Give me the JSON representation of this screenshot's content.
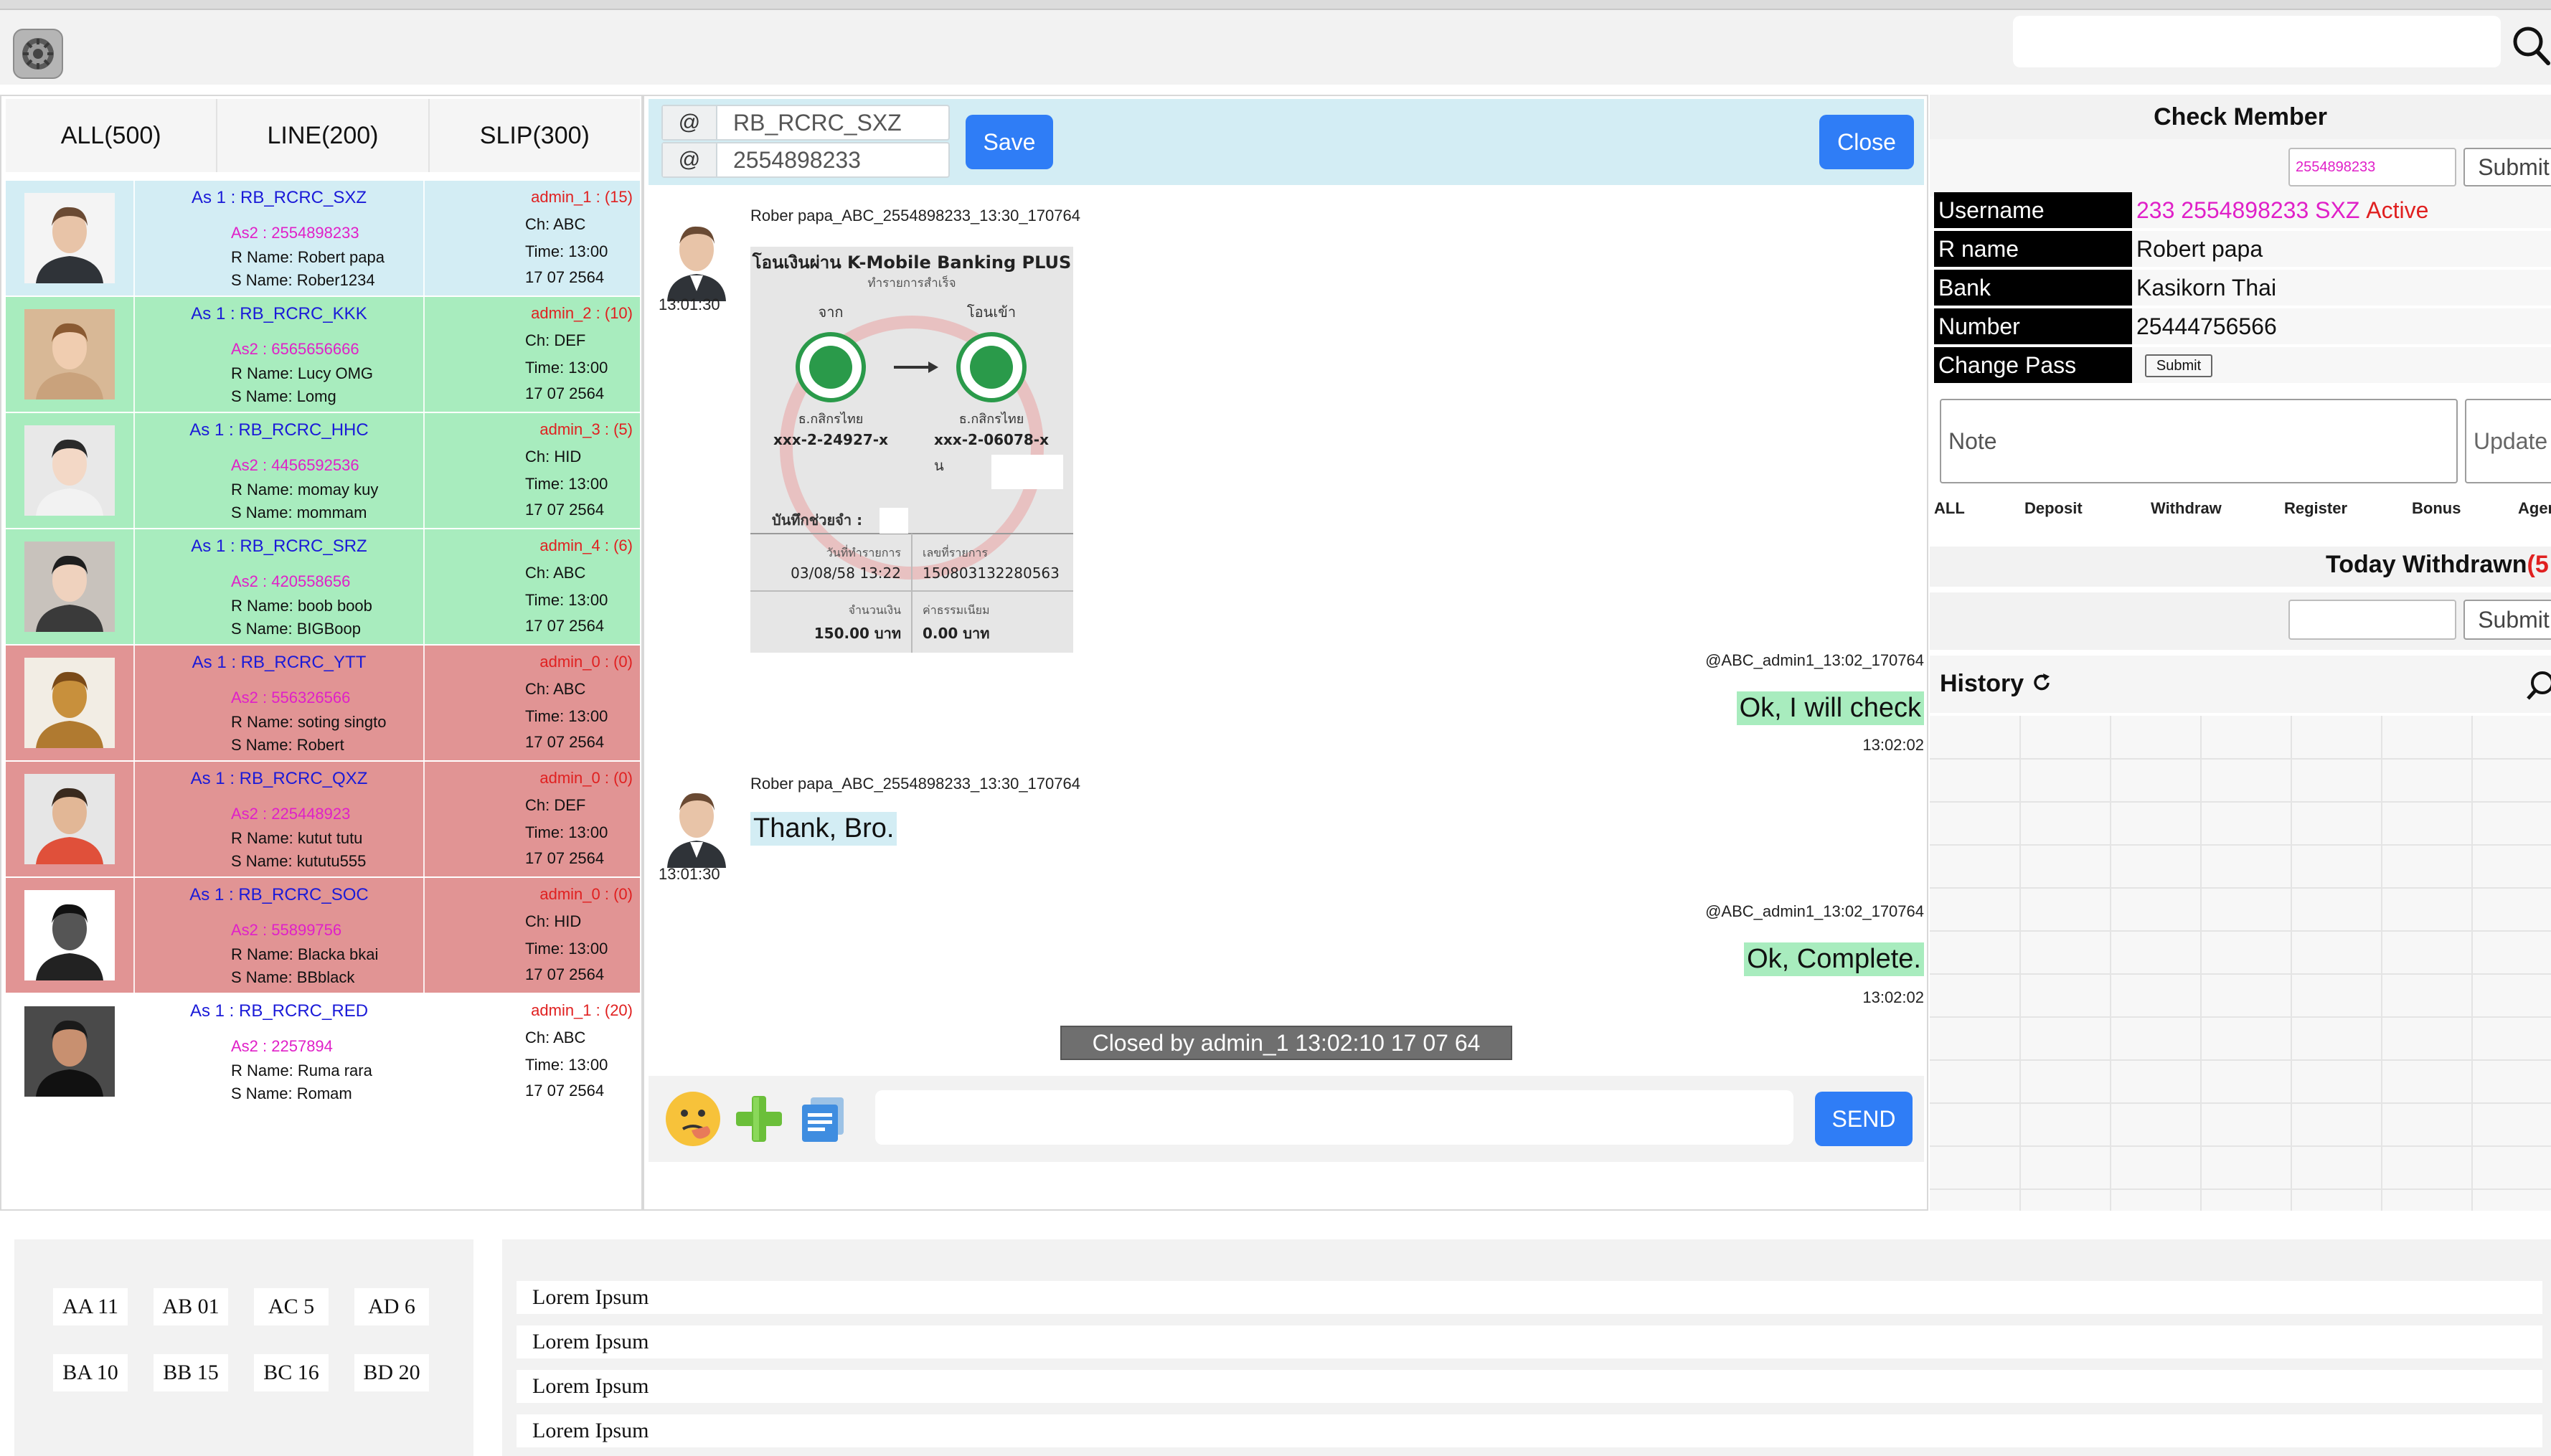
{
  "topbar": {
    "search_placeholder": ""
  },
  "tabs": [
    {
      "label": "ALL(500)"
    },
    {
      "label": "LINE(200)"
    },
    {
      "label": "SLIP(300)"
    }
  ],
  "conversations": [
    {
      "as1": "As 1 : RB_RCRC_SXZ",
      "as2": "As2 : 2554898233",
      "rname": "R Name: Robert papa",
      "sname": "S Name: Rober1234",
      "admin": "admin_1 : (15)",
      "ch": "Ch: ABC",
      "time": "Time: 13:00",
      "date": "17 07 2564"
    },
    {
      "as1": "As 1 : RB_RCRC_KKK",
      "as2": "As2 : 6565656666",
      "rname": "R Name: Lucy OMG",
      "sname": "S Name: Lomg",
      "admin": "admin_2 : (10)",
      "ch": "Ch: DEF",
      "time": "Time: 13:00",
      "date": "17 07 2564"
    },
    {
      "as1": "As 1 : RB_RCRC_HHC",
      "as2": "As2 : 4456592536",
      "rname": "R Name: momay kuy",
      "sname": "S Name: mommam",
      "admin": "admin_3 : (5)",
      "ch": "Ch: HID",
      "time": "Time: 13:00",
      "date": "17 07 2564"
    },
    {
      "as1": "As 1 : RB_RCRC_SRZ",
      "as2": "As2 : 420558656",
      "rname": "R Name: boob boob",
      "sname": "S Name: BIGBoop",
      "admin": "admin_4 : (6)",
      "ch": "Ch: ABC",
      "time": "Time: 13:00",
      "date": "17 07 2564"
    },
    {
      "as1": "As 1 : RB_RCRC_YTT",
      "as2": "As2 : 556326566",
      "rname": "R Name: soting singto",
      "sname": "S Name: Robert",
      "admin": "admin_0 : (0)",
      "ch": "Ch: ABC",
      "time": "Time: 13:00",
      "date": "17 07 2564"
    },
    {
      "as1": "As 1 : RB_RCRC_QXZ",
      "as2": "As2 : 225448923",
      "rname": "R Name: kutut tutu",
      "sname": "S Name: kututu555",
      "admin": "admin_0 : (0)",
      "ch": "Ch: DEF",
      "time": "Time: 13:00",
      "date": "17 07 2564"
    },
    {
      "as1": "As 1 : RB_RCRC_SOC",
      "as2": "As2 : 55899756",
      "rname": "R Name: Blacka bkai",
      "sname": "S Name: BBblack",
      "admin": "admin_0 : (0)",
      "ch": "Ch: HID",
      "time": "Time: 13:00",
      "date": "17 07 2564"
    },
    {
      "as1": "As 1 : RB_RCRC_RED",
      "as2": "As2 : 2257894",
      "rname": "R Name: Ruma rara",
      "sname": "S Name: Romam",
      "admin": "admin_1 : (20)",
      "ch": "Ch: ABC",
      "time": "Time: 13:00",
      "date": "17 07 2564"
    }
  ],
  "chat_header": {
    "at_symbol": "@",
    "field1": "RB_RCRC_SXZ",
    "field2": "2554898233",
    "save_label": "Save",
    "close_label": "Close"
  },
  "messages": {
    "m1_meta": "Rober papa_ABC_2554898233_13:30_170764",
    "m1_time": "13:01:30",
    "slip": {
      "title": "โอนเงินผ่าน K-Mobile Banking PLUS",
      "subtitle": "ทำรายการสำเร็จ",
      "from_label": "จาก",
      "to_label": "โอนเข้า",
      "bank_from": "ธ.กสิกรไทย",
      "bank_to": "ธ.กสิกรไทย",
      "acct_from": "xxx-2-24927-x",
      "acct_to": "xxx-2-06078-x",
      "to_prefix": "น",
      "memo_label": "บันทึกช่วยจำ :",
      "date_label": "วันที่ทำรายการ",
      "ref_label": "เลขที่รายการ",
      "date_value": "03/08/58 13:22",
      "ref_value": "150803132280563",
      "amount_label": "จำนวนเงิน",
      "fee_label": "ค่าธรรมเนียม",
      "amount_value": "150.00 บาท",
      "fee_value": "0.00 บาท"
    },
    "m2_meta": "@ABC_admin1_13:02_170764",
    "m2_text": "Ok, I will check",
    "m2_time": "13:02:02",
    "m3_meta": "Rober papa_ABC_2554898233_13:30_170764",
    "m3_text": "Thank, Bro.",
    "m3_time": "13:01:30",
    "m4_meta": "@ABC_admin1_13:02_170764",
    "m4_text": "Ok, Complete.",
    "m4_time": "13:02:02",
    "closed_text": "Closed by admin_1 13:02:10 17 07 64"
  },
  "composer": {
    "send_label": "SEND"
  },
  "check_member": {
    "title": "Check Member",
    "search_value": "2554898233",
    "submit_label": "Submit",
    "rows": [
      {
        "key": "Username",
        "value_pink": "233 2554898233 SXZ",
        "value_red": "Active"
      },
      {
        "key": "R name",
        "value": "Robert papa"
      },
      {
        "key": "Bank",
        "value": "Kasikorn Thai"
      },
      {
        "key": "Number",
        "value": "25444756566"
      },
      {
        "key": "Change Pass",
        "value": ""
      }
    ],
    "mini_submit": "Submit",
    "note_placeholder": "Note",
    "update_label": "Update",
    "filters": [
      "ALL",
      "Deposit",
      "Withdraw",
      "Register",
      "Bonus",
      "Agent"
    ],
    "today_title": "Today Withdrawn",
    "today_count": "(5",
    "today_submit": "Submit",
    "history_title": "History"
  },
  "bottom": {
    "codes": [
      [
        "AA 11",
        "AB 01",
        "AC 5",
        "AD 6"
      ],
      [
        "BA 10",
        "BB 15",
        "BC 16",
        "BD 20"
      ]
    ],
    "lorem": [
      "Lorem Ipsum",
      "Lorem Ipsum",
      "Lorem Ipsum",
      "Lorem Ipsum"
    ]
  },
  "colors": {
    "blue_row": "#d3edf4",
    "green_row": "#a8ecbe",
    "red_row": "#e19494",
    "accent": "#2f7df6",
    "pink": "#e020c8",
    "red": "#e02020"
  }
}
